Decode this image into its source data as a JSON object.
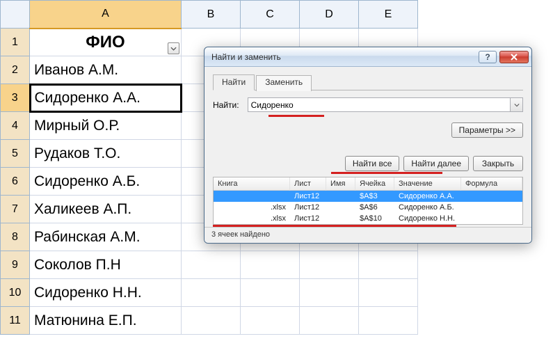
{
  "columns": [
    "A",
    "B",
    "C",
    "D",
    "E"
  ],
  "col_a_title": "ФИО",
  "rows": [
    "Иванов А.М.",
    "Сидоренко А.А.",
    "Мирный О.Р.",
    "Рудаков Т.О.",
    "Сидоренко А.Б.",
    "Халикеев А.П.",
    "Рабинская А.М.",
    "Соколов П.Н",
    "Сидоренко Н.Н.",
    "Матюнина Е.П."
  ],
  "selected_row": 3,
  "dialog": {
    "title": "Найти и заменить",
    "tabs": {
      "find": "Найти",
      "replace": "Заменить"
    },
    "active_tab": "find",
    "find_label": "Найти:",
    "find_value": "Сидоренко",
    "params_btn": "Параметры >>",
    "find_all_btn": "Найти все",
    "find_next_btn": "Найти далее",
    "close_btn": "Закрыть",
    "results_header": {
      "book": "Книга",
      "sheet": "Лист",
      "name": "Имя",
      "cell": "Ячейка",
      "value": "Значение",
      "formula": "Формула"
    },
    "results": [
      {
        "book": "",
        "sheet": "Лист12",
        "name": "",
        "cell": "$A$3",
        "value": "Сидоренко А.А.",
        "selected": true
      },
      {
        "book": ".xlsx",
        "sheet": "Лист12",
        "name": "",
        "cell": "$A$6",
        "value": "Сидоренко А.Б.",
        "selected": false
      },
      {
        "book": ".xlsx",
        "sheet": "Лист12",
        "name": "",
        "cell": "$A$10",
        "value": "Сидоренко Н.Н.",
        "selected": false
      }
    ],
    "status": "3 ячеек найдено"
  }
}
